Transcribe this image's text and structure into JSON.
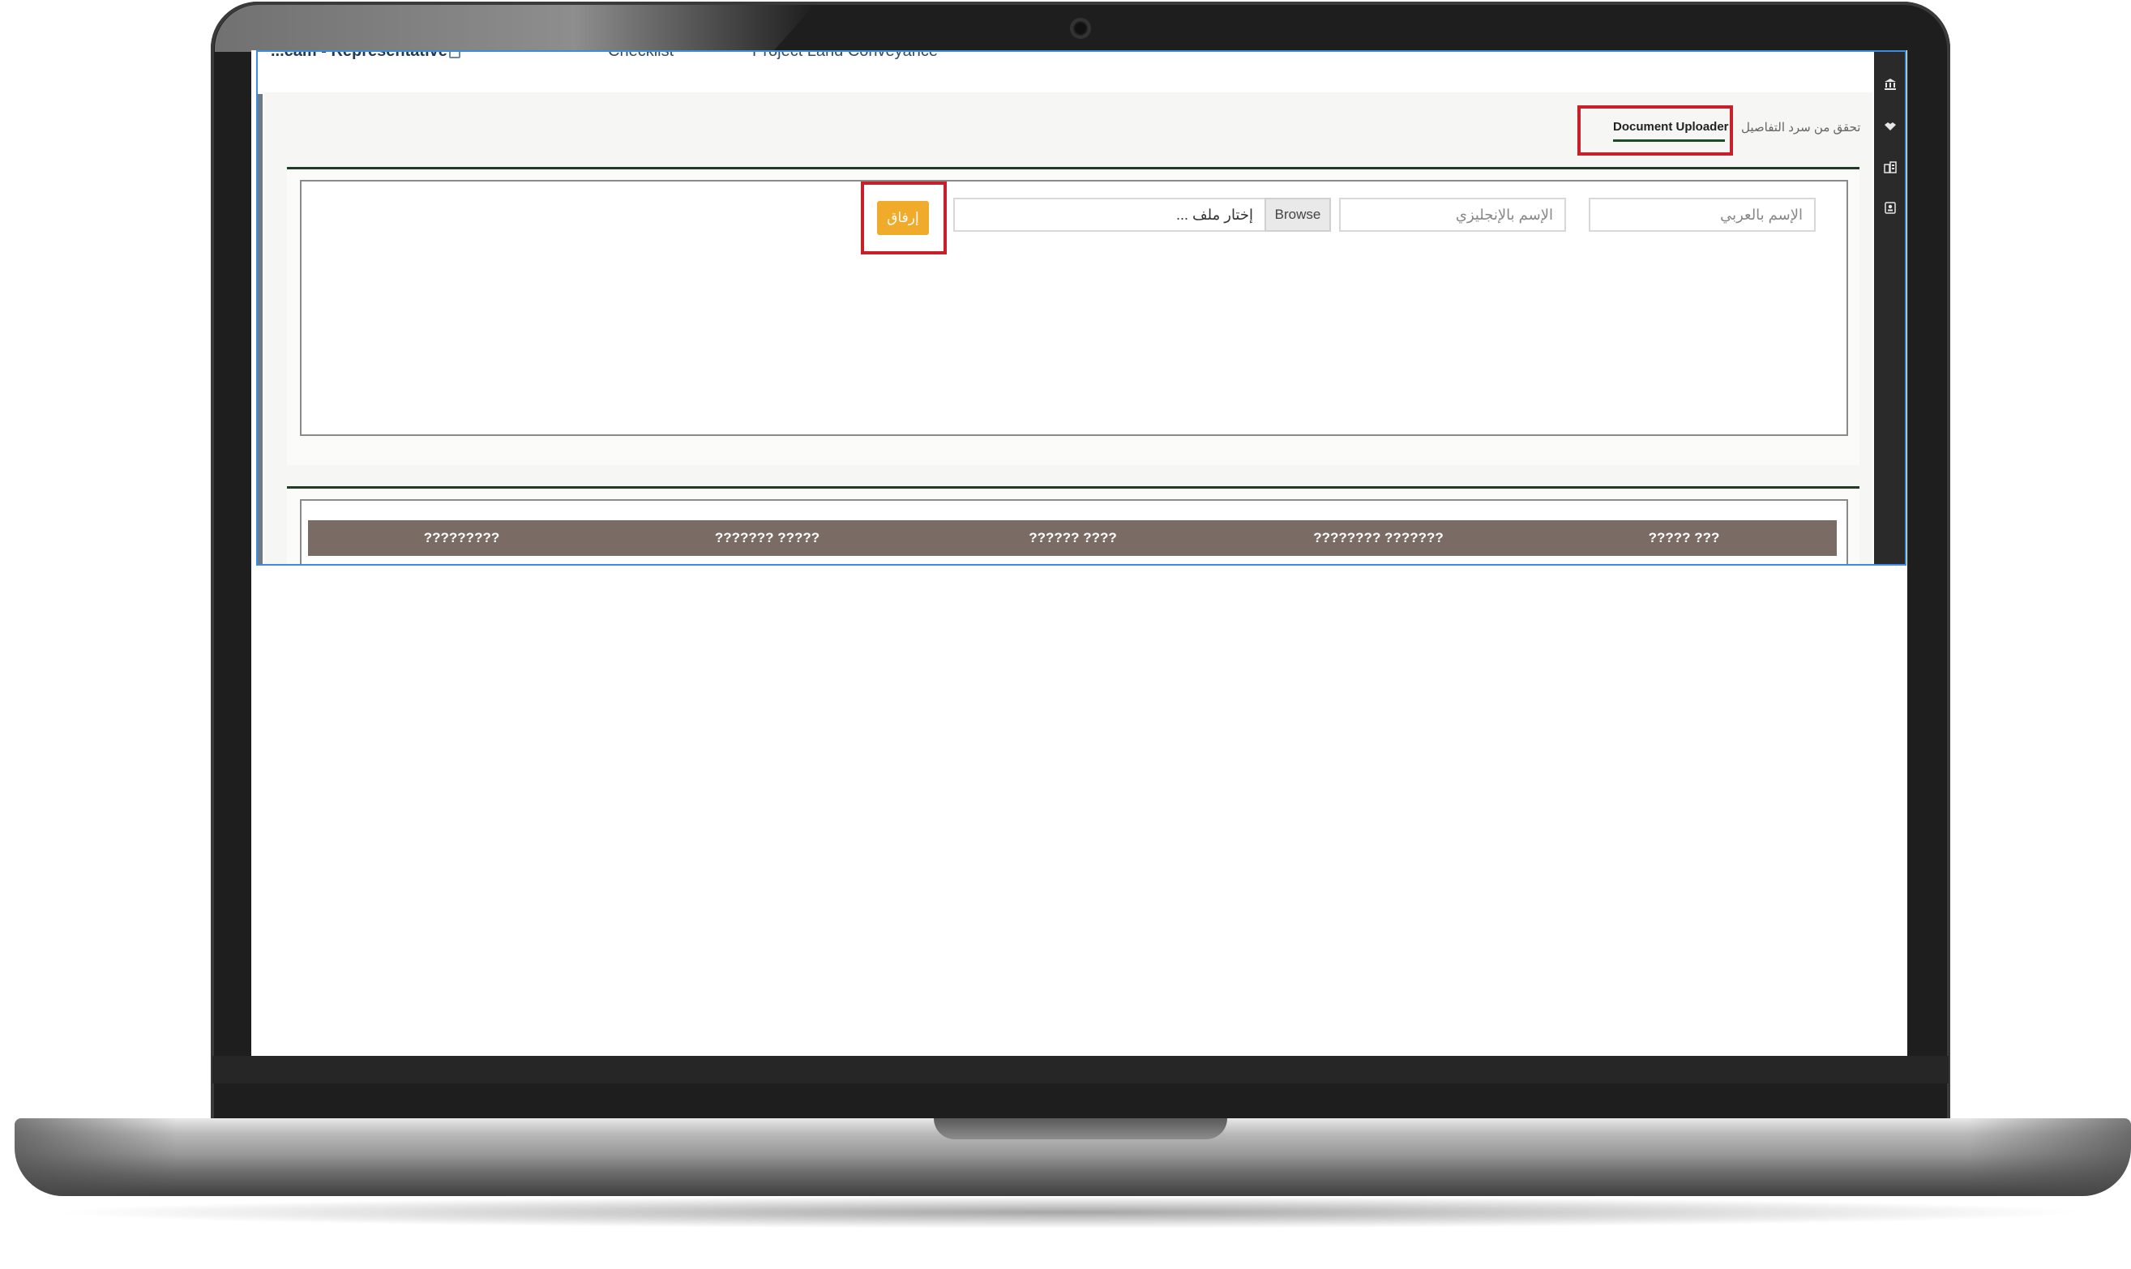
{
  "topbar": {
    "user_label": "...cam - Representative",
    "links": [
      "Checklist",
      "Project Land Conveyance"
    ]
  },
  "tabs": {
    "document_uploader": "Document Uploader",
    "check_details": "تحقق من سرد التفاصيل"
  },
  "upload_form": {
    "arabic_name_placeholder": "الإسم بالعربي",
    "english_name_placeholder": "الإسم بالإنجليزي",
    "file_placeholder": "إختار ملف ...",
    "browse_label": "Browse",
    "attach_label": "إرفاق"
  },
  "table": {
    "headers": [
      "?????????",
      "??????? ?????",
      "?????? ????",
      "???????? ???????",
      "????? ???"
    ]
  },
  "sidebar_icons": [
    "bank-icon",
    "handshake-icon",
    "buildings-icon",
    "id-card-icon"
  ],
  "colors": {
    "accent_orange": "#f0ab2b",
    "highlight_red": "#c8202b",
    "table_header": "#7a6c64",
    "panel_border": "#1e3d24"
  }
}
